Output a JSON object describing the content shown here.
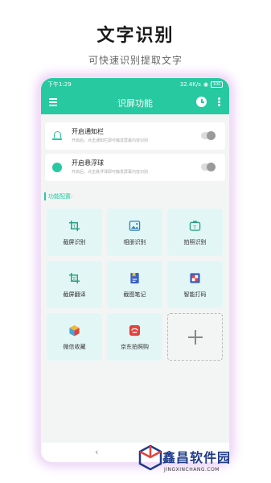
{
  "promo": {
    "title": "文字识别",
    "subtitle": "可快速识别提取文字"
  },
  "statusbar": {
    "time": "下午1:29",
    "network_speed": "32.4K/s",
    "battery": "100"
  },
  "app": {
    "title": "识屏功能",
    "accent": "#27c9a0"
  },
  "settings": [
    {
      "title": "开启通知栏",
      "desc": "开启后，点击通知栏即可触发屏幕内容识别",
      "enabled": false
    },
    {
      "title": "开启悬浮球",
      "desc": "开启后，点击悬浮球即可触发屏幕内容识别",
      "enabled": false
    }
  ],
  "section_label": "功能配置:",
  "features": [
    {
      "label": "截屏识别",
      "icon": "crop-icon"
    },
    {
      "label": "相册识别",
      "icon": "image-icon"
    },
    {
      "label": "拍照识别",
      "icon": "camera-text-icon"
    },
    {
      "label": "截屏翻译",
      "icon": "crop-translate-icon"
    },
    {
      "label": "截图笔记",
      "icon": "note-icon"
    },
    {
      "label": "智能打码",
      "icon": "mosaic-icon"
    },
    {
      "label": "微信收藏",
      "icon": "cube-icon"
    },
    {
      "label": "京东拍照购",
      "icon": "jd-icon"
    }
  ],
  "add_tile": {
    "icon": "plus-icon"
  },
  "watermark": {
    "text": "鑫昌软件园",
    "url": "JINGXINCHANG.COM"
  }
}
